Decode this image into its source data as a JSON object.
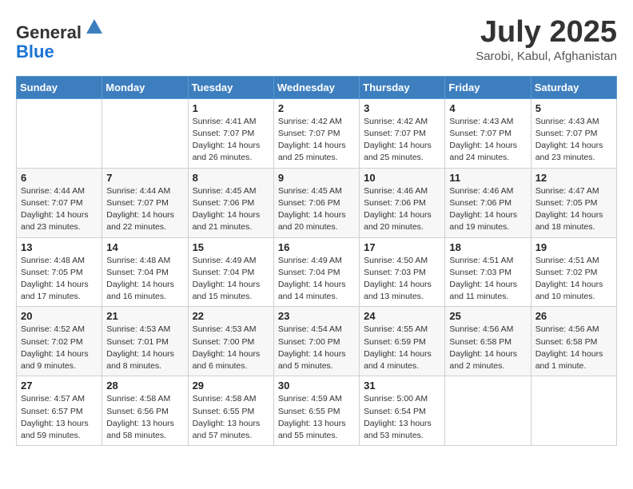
{
  "header": {
    "logo_line1": "General",
    "logo_line2": "Blue",
    "month": "July 2025",
    "location": "Sarobi, Kabul, Afghanistan"
  },
  "days_of_week": [
    "Sunday",
    "Monday",
    "Tuesday",
    "Wednesday",
    "Thursday",
    "Friday",
    "Saturday"
  ],
  "weeks": [
    [
      {
        "day": "",
        "sunrise": "",
        "sunset": "",
        "daylight": ""
      },
      {
        "day": "",
        "sunrise": "",
        "sunset": "",
        "daylight": ""
      },
      {
        "day": "1",
        "sunrise": "Sunrise: 4:41 AM",
        "sunset": "Sunset: 7:07 PM",
        "daylight": "Daylight: 14 hours and 26 minutes."
      },
      {
        "day": "2",
        "sunrise": "Sunrise: 4:42 AM",
        "sunset": "Sunset: 7:07 PM",
        "daylight": "Daylight: 14 hours and 25 minutes."
      },
      {
        "day": "3",
        "sunrise": "Sunrise: 4:42 AM",
        "sunset": "Sunset: 7:07 PM",
        "daylight": "Daylight: 14 hours and 25 minutes."
      },
      {
        "day": "4",
        "sunrise": "Sunrise: 4:43 AM",
        "sunset": "Sunset: 7:07 PM",
        "daylight": "Daylight: 14 hours and 24 minutes."
      },
      {
        "day": "5",
        "sunrise": "Sunrise: 4:43 AM",
        "sunset": "Sunset: 7:07 PM",
        "daylight": "Daylight: 14 hours and 23 minutes."
      }
    ],
    [
      {
        "day": "6",
        "sunrise": "Sunrise: 4:44 AM",
        "sunset": "Sunset: 7:07 PM",
        "daylight": "Daylight: 14 hours and 23 minutes."
      },
      {
        "day": "7",
        "sunrise": "Sunrise: 4:44 AM",
        "sunset": "Sunset: 7:07 PM",
        "daylight": "Daylight: 14 hours and 22 minutes."
      },
      {
        "day": "8",
        "sunrise": "Sunrise: 4:45 AM",
        "sunset": "Sunset: 7:06 PM",
        "daylight": "Daylight: 14 hours and 21 minutes."
      },
      {
        "day": "9",
        "sunrise": "Sunrise: 4:45 AM",
        "sunset": "Sunset: 7:06 PM",
        "daylight": "Daylight: 14 hours and 20 minutes."
      },
      {
        "day": "10",
        "sunrise": "Sunrise: 4:46 AM",
        "sunset": "Sunset: 7:06 PM",
        "daylight": "Daylight: 14 hours and 20 minutes."
      },
      {
        "day": "11",
        "sunrise": "Sunrise: 4:46 AM",
        "sunset": "Sunset: 7:06 PM",
        "daylight": "Daylight: 14 hours and 19 minutes."
      },
      {
        "day": "12",
        "sunrise": "Sunrise: 4:47 AM",
        "sunset": "Sunset: 7:05 PM",
        "daylight": "Daylight: 14 hours and 18 minutes."
      }
    ],
    [
      {
        "day": "13",
        "sunrise": "Sunrise: 4:48 AM",
        "sunset": "Sunset: 7:05 PM",
        "daylight": "Daylight: 14 hours and 17 minutes."
      },
      {
        "day": "14",
        "sunrise": "Sunrise: 4:48 AM",
        "sunset": "Sunset: 7:04 PM",
        "daylight": "Daylight: 14 hours and 16 minutes."
      },
      {
        "day": "15",
        "sunrise": "Sunrise: 4:49 AM",
        "sunset": "Sunset: 7:04 PM",
        "daylight": "Daylight: 14 hours and 15 minutes."
      },
      {
        "day": "16",
        "sunrise": "Sunrise: 4:49 AM",
        "sunset": "Sunset: 7:04 PM",
        "daylight": "Daylight: 14 hours and 14 minutes."
      },
      {
        "day": "17",
        "sunrise": "Sunrise: 4:50 AM",
        "sunset": "Sunset: 7:03 PM",
        "daylight": "Daylight: 14 hours and 13 minutes."
      },
      {
        "day": "18",
        "sunrise": "Sunrise: 4:51 AM",
        "sunset": "Sunset: 7:03 PM",
        "daylight": "Daylight: 14 hours and 11 minutes."
      },
      {
        "day": "19",
        "sunrise": "Sunrise: 4:51 AM",
        "sunset": "Sunset: 7:02 PM",
        "daylight": "Daylight: 14 hours and 10 minutes."
      }
    ],
    [
      {
        "day": "20",
        "sunrise": "Sunrise: 4:52 AM",
        "sunset": "Sunset: 7:02 PM",
        "daylight": "Daylight: 14 hours and 9 minutes."
      },
      {
        "day": "21",
        "sunrise": "Sunrise: 4:53 AM",
        "sunset": "Sunset: 7:01 PM",
        "daylight": "Daylight: 14 hours and 8 minutes."
      },
      {
        "day": "22",
        "sunrise": "Sunrise: 4:53 AM",
        "sunset": "Sunset: 7:00 PM",
        "daylight": "Daylight: 14 hours and 6 minutes."
      },
      {
        "day": "23",
        "sunrise": "Sunrise: 4:54 AM",
        "sunset": "Sunset: 7:00 PM",
        "daylight": "Daylight: 14 hours and 5 minutes."
      },
      {
        "day": "24",
        "sunrise": "Sunrise: 4:55 AM",
        "sunset": "Sunset: 6:59 PM",
        "daylight": "Daylight: 14 hours and 4 minutes."
      },
      {
        "day": "25",
        "sunrise": "Sunrise: 4:56 AM",
        "sunset": "Sunset: 6:58 PM",
        "daylight": "Daylight: 14 hours and 2 minutes."
      },
      {
        "day": "26",
        "sunrise": "Sunrise: 4:56 AM",
        "sunset": "Sunset: 6:58 PM",
        "daylight": "Daylight: 14 hours and 1 minute."
      }
    ],
    [
      {
        "day": "27",
        "sunrise": "Sunrise: 4:57 AM",
        "sunset": "Sunset: 6:57 PM",
        "daylight": "Daylight: 13 hours and 59 minutes."
      },
      {
        "day": "28",
        "sunrise": "Sunrise: 4:58 AM",
        "sunset": "Sunset: 6:56 PM",
        "daylight": "Daylight: 13 hours and 58 minutes."
      },
      {
        "day": "29",
        "sunrise": "Sunrise: 4:58 AM",
        "sunset": "Sunset: 6:55 PM",
        "daylight": "Daylight: 13 hours and 57 minutes."
      },
      {
        "day": "30",
        "sunrise": "Sunrise: 4:59 AM",
        "sunset": "Sunset: 6:55 PM",
        "daylight": "Daylight: 13 hours and 55 minutes."
      },
      {
        "day": "31",
        "sunrise": "Sunrise: 5:00 AM",
        "sunset": "Sunset: 6:54 PM",
        "daylight": "Daylight: 13 hours and 53 minutes."
      },
      {
        "day": "",
        "sunrise": "",
        "sunset": "",
        "daylight": ""
      },
      {
        "day": "",
        "sunrise": "",
        "sunset": "",
        "daylight": ""
      }
    ]
  ]
}
